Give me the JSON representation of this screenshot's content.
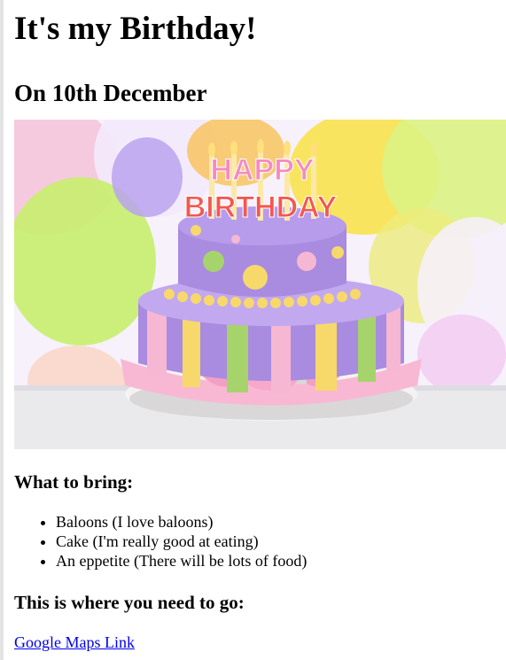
{
  "page": {
    "title": "It's my Birthday!",
    "subtitle": "On 10th December"
  },
  "hero_image": {
    "alt": "Birthday cake",
    "candle_text_line1": "HAPPY",
    "candle_text_line2": "BIRTHDAY"
  },
  "bring": {
    "heading": "What to bring:",
    "items": [
      "Baloons (I love baloons)",
      "Cake (I'm really good at eating)",
      "An eppetite (There will be lots of food)"
    ]
  },
  "directions": {
    "heading": "This is where you need to go:",
    "link_text": "Google Maps Link"
  },
  "colors": {
    "link": "#0000ee",
    "cake_purple": "#a98be0",
    "cake_pink": "#f6b7d2",
    "cake_yellow": "#f7d86b",
    "cake_green": "#a6d36b"
  }
}
